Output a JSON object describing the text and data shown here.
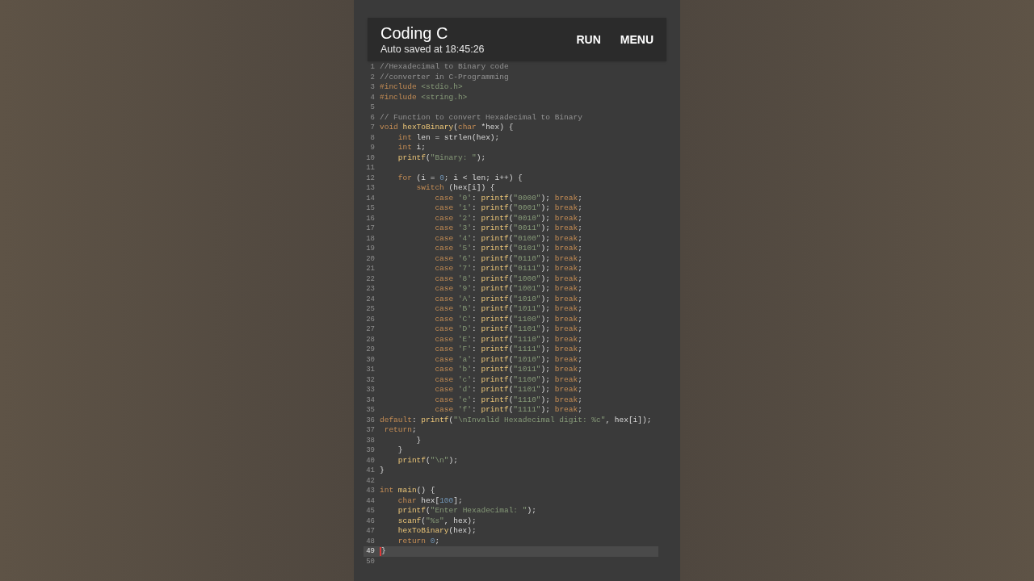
{
  "app_bar": {
    "title": "Coding C",
    "subtitle": "Auto saved at 18:45:26",
    "actions": [
      "RUN",
      "MENU"
    ]
  },
  "editor": {
    "lines": [
      {
        "number": "1",
        "current": false,
        "tokens": [
          {
            "kind": "comment",
            "text": "//Hexadecimal to Binary code"
          }
        ]
      },
      {
        "number": "2",
        "current": false,
        "tokens": [
          {
            "kind": "comment",
            "text": "//converter in C-Programming"
          }
        ]
      },
      {
        "number": "3",
        "current": false,
        "tokens": [
          {
            "kind": "keyword",
            "text": "#include"
          },
          {
            "kind": "string",
            "text": " <stdio.h>"
          }
        ]
      },
      {
        "number": "4",
        "current": false,
        "tokens": [
          {
            "kind": "keyword",
            "text": "#include"
          },
          {
            "kind": "string",
            "text": " <string.h>"
          }
        ]
      },
      {
        "number": "5",
        "current": false
      },
      {
        "number": "6",
        "current": false,
        "tokens": [
          {
            "kind": "comment",
            "text": "// Function to convert Hexadecimal to Binary"
          }
        ]
      },
      {
        "number": "7",
        "current": false,
        "tokens": [
          {
            "kind": "keyword",
            "text": "void "
          },
          {
            "kind": "func",
            "text": "hexToBinary"
          },
          {
            "kind": "plain",
            "text": "("
          },
          {
            "kind": "keyword",
            "text": "char"
          },
          {
            "kind": "plain",
            "text": " *hex) {"
          }
        ]
      },
      {
        "number": "8",
        "current": false,
        "tokens": [
          {
            "kind": "keyword",
            "text": "    int"
          },
          {
            "kind": "plain",
            "text": " len = strlen(hex);"
          }
        ]
      },
      {
        "number": "9",
        "current": false,
        "tokens": [
          {
            "kind": "keyword",
            "text": "    int"
          },
          {
            "kind": "plain",
            "text": " i;"
          }
        ]
      },
      {
        "number": "10",
        "current": false,
        "tokens": [
          {
            "kind": "func",
            "text": "    printf"
          },
          {
            "kind": "plain",
            "text": "("
          },
          {
            "kind": "string",
            "text": "\"Binary: \""
          },
          {
            "kind": "plain",
            "text": ");"
          }
        ]
      },
      {
        "number": "11",
        "current": false
      },
      {
        "number": "12",
        "current": false,
        "tokens": [
          {
            "kind": "keyword",
            "text": "    for"
          },
          {
            "kind": "plain",
            "text": " (i = "
          },
          {
            "kind": "number",
            "text": "0"
          },
          {
            "kind": "plain",
            "text": "; i < len; i++) {"
          }
        ]
      },
      {
        "number": "13",
        "current": false,
        "tokens": [
          {
            "kind": "keyword",
            "text": "        switch"
          },
          {
            "kind": "plain",
            "text": " (hex[i]) {"
          }
        ]
      },
      {
        "number": "14",
        "current": false,
        "tokens": [
          {
            "kind": "keyword",
            "text": "            case "
          },
          {
            "kind": "string",
            "text": "'0'"
          },
          {
            "kind": "plain",
            "text": ": "
          },
          {
            "kind": "func",
            "text": "printf"
          },
          {
            "kind": "plain",
            "text": "("
          },
          {
            "kind": "string",
            "text": "\"0000\""
          },
          {
            "kind": "plain",
            "text": "); "
          },
          {
            "kind": "keyword",
            "text": "break"
          },
          {
            "kind": "plain",
            "text": ";"
          }
        ]
      },
      {
        "number": "15",
        "current": false,
        "tokens": [
          {
            "kind": "keyword",
            "text": "            case "
          },
          {
            "kind": "string",
            "text": "'1'"
          },
          {
            "kind": "plain",
            "text": ": "
          },
          {
            "kind": "func",
            "text": "printf"
          },
          {
            "kind": "plain",
            "text": "("
          },
          {
            "kind": "string",
            "text": "\"0001\""
          },
          {
            "kind": "plain",
            "text": "); "
          },
          {
            "kind": "keyword",
            "text": "break"
          },
          {
            "kind": "plain",
            "text": ";"
          }
        ]
      },
      {
        "number": "16",
        "current": false,
        "tokens": [
          {
            "kind": "keyword",
            "text": "            case "
          },
          {
            "kind": "string",
            "text": "'2'"
          },
          {
            "kind": "plain",
            "text": ": "
          },
          {
            "kind": "func",
            "text": "printf"
          },
          {
            "kind": "plain",
            "text": "("
          },
          {
            "kind": "string",
            "text": "\"0010\""
          },
          {
            "kind": "plain",
            "text": "); "
          },
          {
            "kind": "keyword",
            "text": "break"
          },
          {
            "kind": "plain",
            "text": ";"
          }
        ]
      },
      {
        "number": "17",
        "current": false,
        "tokens": [
          {
            "kind": "keyword",
            "text": "            case "
          },
          {
            "kind": "string",
            "text": "'3'"
          },
          {
            "kind": "plain",
            "text": ": "
          },
          {
            "kind": "func",
            "text": "printf"
          },
          {
            "kind": "plain",
            "text": "("
          },
          {
            "kind": "string",
            "text": "\"0011\""
          },
          {
            "kind": "plain",
            "text": "); "
          },
          {
            "kind": "keyword",
            "text": "break"
          },
          {
            "kind": "plain",
            "text": ";"
          }
        ]
      },
      {
        "number": "18",
        "current": false,
        "tokens": [
          {
            "kind": "keyword",
            "text": "            case "
          },
          {
            "kind": "string",
            "text": "'4'"
          },
          {
            "kind": "plain",
            "text": ": "
          },
          {
            "kind": "func",
            "text": "printf"
          },
          {
            "kind": "plain",
            "text": "("
          },
          {
            "kind": "string",
            "text": "\"0100\""
          },
          {
            "kind": "plain",
            "text": "); "
          },
          {
            "kind": "keyword",
            "text": "break"
          },
          {
            "kind": "plain",
            "text": ";"
          }
        ]
      },
      {
        "number": "19",
        "current": false,
        "tokens": [
          {
            "kind": "keyword",
            "text": "            case "
          },
          {
            "kind": "string",
            "text": "'5'"
          },
          {
            "kind": "plain",
            "text": ": "
          },
          {
            "kind": "func",
            "text": "printf"
          },
          {
            "kind": "plain",
            "text": "("
          },
          {
            "kind": "string",
            "text": "\"0101\""
          },
          {
            "kind": "plain",
            "text": "); "
          },
          {
            "kind": "keyword",
            "text": "break"
          },
          {
            "kind": "plain",
            "text": ";"
          }
        ]
      },
      {
        "number": "20",
        "current": false,
        "tokens": [
          {
            "kind": "keyword",
            "text": "            case "
          },
          {
            "kind": "string",
            "text": "'6'"
          },
          {
            "kind": "plain",
            "text": ": "
          },
          {
            "kind": "func",
            "text": "printf"
          },
          {
            "kind": "plain",
            "text": "("
          },
          {
            "kind": "string",
            "text": "\"0110\""
          },
          {
            "kind": "plain",
            "text": "); "
          },
          {
            "kind": "keyword",
            "text": "break"
          },
          {
            "kind": "plain",
            "text": ";"
          }
        ]
      },
      {
        "number": "21",
        "current": false,
        "tokens": [
          {
            "kind": "keyword",
            "text": "            case "
          },
          {
            "kind": "string",
            "text": "'7'"
          },
          {
            "kind": "plain",
            "text": ": "
          },
          {
            "kind": "func",
            "text": "printf"
          },
          {
            "kind": "plain",
            "text": "("
          },
          {
            "kind": "string",
            "text": "\"0111\""
          },
          {
            "kind": "plain",
            "text": "); "
          },
          {
            "kind": "keyword",
            "text": "break"
          },
          {
            "kind": "plain",
            "text": ";"
          }
        ]
      },
      {
        "number": "22",
        "current": false,
        "tokens": [
          {
            "kind": "keyword",
            "text": "            case "
          },
          {
            "kind": "string",
            "text": "'8'"
          },
          {
            "kind": "plain",
            "text": ": "
          },
          {
            "kind": "func",
            "text": "printf"
          },
          {
            "kind": "plain",
            "text": "("
          },
          {
            "kind": "string",
            "text": "\"1000\""
          },
          {
            "kind": "plain",
            "text": "); "
          },
          {
            "kind": "keyword",
            "text": "break"
          },
          {
            "kind": "plain",
            "text": ";"
          }
        ]
      },
      {
        "number": "23",
        "current": false,
        "tokens": [
          {
            "kind": "keyword",
            "text": "            case "
          },
          {
            "kind": "string",
            "text": "'9'"
          },
          {
            "kind": "plain",
            "text": ": "
          },
          {
            "kind": "func",
            "text": "printf"
          },
          {
            "kind": "plain",
            "text": "("
          },
          {
            "kind": "string",
            "text": "\"1001\""
          },
          {
            "kind": "plain",
            "text": "); "
          },
          {
            "kind": "keyword",
            "text": "break"
          },
          {
            "kind": "plain",
            "text": ";"
          }
        ]
      },
      {
        "number": "24",
        "current": false,
        "tokens": [
          {
            "kind": "keyword",
            "text": "            case "
          },
          {
            "kind": "string",
            "text": "'A'"
          },
          {
            "kind": "plain",
            "text": ": "
          },
          {
            "kind": "func",
            "text": "printf"
          },
          {
            "kind": "plain",
            "text": "("
          },
          {
            "kind": "string",
            "text": "\"1010\""
          },
          {
            "kind": "plain",
            "text": "); "
          },
          {
            "kind": "keyword",
            "text": "break"
          },
          {
            "kind": "plain",
            "text": ";"
          }
        ]
      },
      {
        "number": "25",
        "current": false,
        "tokens": [
          {
            "kind": "keyword",
            "text": "            case "
          },
          {
            "kind": "string",
            "text": "'B'"
          },
          {
            "kind": "plain",
            "text": ": "
          },
          {
            "kind": "func",
            "text": "printf"
          },
          {
            "kind": "plain",
            "text": "("
          },
          {
            "kind": "string",
            "text": "\"1011\""
          },
          {
            "kind": "plain",
            "text": "); "
          },
          {
            "kind": "keyword",
            "text": "break"
          },
          {
            "kind": "plain",
            "text": ";"
          }
        ]
      },
      {
        "number": "26",
        "current": false,
        "tokens": [
          {
            "kind": "keyword",
            "text": "            case "
          },
          {
            "kind": "string",
            "text": "'C'"
          },
          {
            "kind": "plain",
            "text": ": "
          },
          {
            "kind": "func",
            "text": "printf"
          },
          {
            "kind": "plain",
            "text": "("
          },
          {
            "kind": "string",
            "text": "\"1100\""
          },
          {
            "kind": "plain",
            "text": "); "
          },
          {
            "kind": "keyword",
            "text": "break"
          },
          {
            "kind": "plain",
            "text": ";"
          }
        ]
      },
      {
        "number": "27",
        "current": false,
        "tokens": [
          {
            "kind": "keyword",
            "text": "            case "
          },
          {
            "kind": "string",
            "text": "'D'"
          },
          {
            "kind": "plain",
            "text": ": "
          },
          {
            "kind": "func",
            "text": "printf"
          },
          {
            "kind": "plain",
            "text": "("
          },
          {
            "kind": "string",
            "text": "\"1101\""
          },
          {
            "kind": "plain",
            "text": "); "
          },
          {
            "kind": "keyword",
            "text": "break"
          },
          {
            "kind": "plain",
            "text": ";"
          }
        ]
      },
      {
        "number": "28",
        "current": false,
        "tokens": [
          {
            "kind": "keyword",
            "text": "            case "
          },
          {
            "kind": "string",
            "text": "'E'"
          },
          {
            "kind": "plain",
            "text": ": "
          },
          {
            "kind": "func",
            "text": "printf"
          },
          {
            "kind": "plain",
            "text": "("
          },
          {
            "kind": "string",
            "text": "\"1110\""
          },
          {
            "kind": "plain",
            "text": "); "
          },
          {
            "kind": "keyword",
            "text": "break"
          },
          {
            "kind": "plain",
            "text": ";"
          }
        ]
      },
      {
        "number": "29",
        "current": false,
        "tokens": [
          {
            "kind": "keyword",
            "text": "            case "
          },
          {
            "kind": "string",
            "text": "'F'"
          },
          {
            "kind": "plain",
            "text": ": "
          },
          {
            "kind": "func",
            "text": "printf"
          },
          {
            "kind": "plain",
            "text": "("
          },
          {
            "kind": "string",
            "text": "\"1111\""
          },
          {
            "kind": "plain",
            "text": "); "
          },
          {
            "kind": "keyword",
            "text": "break"
          },
          {
            "kind": "plain",
            "text": ";"
          }
        ]
      },
      {
        "number": "30",
        "current": false,
        "tokens": [
          {
            "kind": "keyword",
            "text": "            case "
          },
          {
            "kind": "string",
            "text": "'a'"
          },
          {
            "kind": "plain",
            "text": ": "
          },
          {
            "kind": "func",
            "text": "printf"
          },
          {
            "kind": "plain",
            "text": "("
          },
          {
            "kind": "string",
            "text": "\"1010\""
          },
          {
            "kind": "plain",
            "text": "); "
          },
          {
            "kind": "keyword",
            "text": "break"
          },
          {
            "kind": "plain",
            "text": ";"
          }
        ]
      },
      {
        "number": "31",
        "current": false,
        "tokens": [
          {
            "kind": "keyword",
            "text": "            case "
          },
          {
            "kind": "string",
            "text": "'b'"
          },
          {
            "kind": "plain",
            "text": ": "
          },
          {
            "kind": "func",
            "text": "printf"
          },
          {
            "kind": "plain",
            "text": "("
          },
          {
            "kind": "string",
            "text": "\"1011\""
          },
          {
            "kind": "plain",
            "text": "); "
          },
          {
            "kind": "keyword",
            "text": "break"
          },
          {
            "kind": "plain",
            "text": ";"
          }
        ]
      },
      {
        "number": "32",
        "current": false,
        "tokens": [
          {
            "kind": "keyword",
            "text": "            case "
          },
          {
            "kind": "string",
            "text": "'c'"
          },
          {
            "kind": "plain",
            "text": ": "
          },
          {
            "kind": "func",
            "text": "printf"
          },
          {
            "kind": "plain",
            "text": "("
          },
          {
            "kind": "string",
            "text": "\"1100\""
          },
          {
            "kind": "plain",
            "text": "); "
          },
          {
            "kind": "keyword",
            "text": "break"
          },
          {
            "kind": "plain",
            "text": ";"
          }
        ]
      },
      {
        "number": "33",
        "current": false,
        "tokens": [
          {
            "kind": "keyword",
            "text": "            case "
          },
          {
            "kind": "string",
            "text": "'d'"
          },
          {
            "kind": "plain",
            "text": ": "
          },
          {
            "kind": "func",
            "text": "printf"
          },
          {
            "kind": "plain",
            "text": "("
          },
          {
            "kind": "string",
            "text": "\"1101\""
          },
          {
            "kind": "plain",
            "text": "); "
          },
          {
            "kind": "keyword",
            "text": "break"
          },
          {
            "kind": "plain",
            "text": ";"
          }
        ]
      },
      {
        "number": "34",
        "current": false,
        "tokens": [
          {
            "kind": "keyword",
            "text": "            case "
          },
          {
            "kind": "string",
            "text": "'e'"
          },
          {
            "kind": "plain",
            "text": ": "
          },
          {
            "kind": "func",
            "text": "printf"
          },
          {
            "kind": "plain",
            "text": "("
          },
          {
            "kind": "string",
            "text": "\"1110\""
          },
          {
            "kind": "plain",
            "text": "); "
          },
          {
            "kind": "keyword",
            "text": "break"
          },
          {
            "kind": "plain",
            "text": ";"
          }
        ]
      },
      {
        "number": "35",
        "current": false,
        "tokens": [
          {
            "kind": "keyword",
            "text": "            case "
          },
          {
            "kind": "string",
            "text": "'f'"
          },
          {
            "kind": "plain",
            "text": ": "
          },
          {
            "kind": "func",
            "text": "printf"
          },
          {
            "kind": "plain",
            "text": "("
          },
          {
            "kind": "string",
            "text": "\"1111\""
          },
          {
            "kind": "plain",
            "text": "); "
          },
          {
            "kind": "keyword",
            "text": "break"
          },
          {
            "kind": "plain",
            "text": ";"
          }
        ]
      },
      {
        "number": "36",
        "current": false,
        "tokens": [
          {
            "kind": "keyword",
            "text": "default"
          },
          {
            "kind": "plain",
            "text": ": "
          },
          {
            "kind": "func",
            "text": "printf"
          },
          {
            "kind": "plain",
            "text": "("
          },
          {
            "kind": "string",
            "text": "\"\\nInvalid Hexadecimal digit: %c\""
          },
          {
            "kind": "plain",
            "text": ", hex[i]);"
          }
        ]
      },
      {
        "number": "37",
        "current": false,
        "tokens": [
          {
            "kind": "keyword",
            "text": " return"
          },
          {
            "kind": "plain",
            "text": ";"
          }
        ]
      },
      {
        "number": "38",
        "current": false,
        "tokens": [
          {
            "kind": "plain",
            "text": "        }"
          }
        ]
      },
      {
        "number": "39",
        "current": false,
        "tokens": [
          {
            "kind": "plain",
            "text": "    }"
          }
        ]
      },
      {
        "number": "40",
        "current": false,
        "tokens": [
          {
            "kind": "func",
            "text": "    printf"
          },
          {
            "kind": "plain",
            "text": "("
          },
          {
            "kind": "string",
            "text": "\"\\n\""
          },
          {
            "kind": "plain",
            "text": ");"
          }
        ]
      },
      {
        "number": "41",
        "current": false,
        "tokens": [
          {
            "kind": "plain",
            "text": "}"
          }
        ]
      },
      {
        "number": "42",
        "current": false
      },
      {
        "number": "43",
        "current": false,
        "tokens": [
          {
            "kind": "keyword",
            "text": "int "
          },
          {
            "kind": "func",
            "text": "main"
          },
          {
            "kind": "plain",
            "text": "() {"
          }
        ]
      },
      {
        "number": "44",
        "current": false,
        "tokens": [
          {
            "kind": "keyword",
            "text": "    char"
          },
          {
            "kind": "plain",
            "text": " hex["
          },
          {
            "kind": "number",
            "text": "100"
          },
          {
            "kind": "plain",
            "text": "];"
          }
        ]
      },
      {
        "number": "45",
        "current": false,
        "tokens": [
          {
            "kind": "func",
            "text": "    printf"
          },
          {
            "kind": "plain",
            "text": "("
          },
          {
            "kind": "string",
            "text": "\"Enter Hexadecimal: \""
          },
          {
            "kind": "plain",
            "text": ");"
          }
        ]
      },
      {
        "number": "46",
        "current": false,
        "tokens": [
          {
            "kind": "func",
            "text": "    scanf"
          },
          {
            "kind": "plain",
            "text": "("
          },
          {
            "kind": "string",
            "text": "\"%s\""
          },
          {
            "kind": "plain",
            "text": ", hex);"
          }
        ]
      },
      {
        "number": "47",
        "current": false,
        "tokens": [
          {
            "kind": "func",
            "text": "    hexToBinary"
          },
          {
            "kind": "plain",
            "text": "(hex);"
          }
        ]
      },
      {
        "number": "48",
        "current": false,
        "tokens": [
          {
            "kind": "keyword",
            "text": "    return "
          },
          {
            "kind": "number",
            "text": "0"
          },
          {
            "kind": "plain",
            "text": ";"
          }
        ]
      },
      {
        "number": "49",
        "current": true,
        "tokens": [
          {
            "kind": "plain",
            "text": "}"
          }
        ]
      },
      {
        "number": "50",
        "current": false
      }
    ]
  }
}
